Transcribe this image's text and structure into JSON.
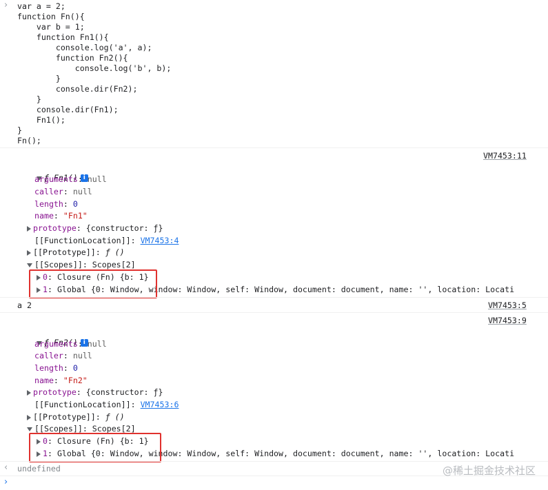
{
  "source_code": [
    "var a = 2;",
    "function Fn(){",
    "    var b = 1;",
    "    function Fn1(){",
    "        console.log('a', a);",
    "        function Fn2(){",
    "            console.log('b', b);",
    "        }",
    "        console.dir(Fn2);",
    "    }",
    "    console.dir(Fn1);",
    "    Fn1();",
    "}",
    "Fn();"
  ],
  "input_prompt_icon": "chevron-right-icon",
  "fn1_block": {
    "source_link": "VM7453:11",
    "header_f": "ƒ",
    "header_name": "Fn1()",
    "info_icon_label": "i",
    "arguments_key": "arguments",
    "arguments_val": "null",
    "caller_key": "caller",
    "caller_val": "null",
    "length_key": "length",
    "length_val": "0",
    "name_key": "name",
    "name_val": "\"Fn1\"",
    "prototype_key": "prototype",
    "prototype_val": "{constructor: ƒ}",
    "function_location_key": "[[FunctionLocation]]",
    "function_location_val": "VM7453:4",
    "proto_key": "[[Prototype]]",
    "proto_val": "ƒ ()",
    "scopes_key": "[[Scopes]]",
    "scopes_val": "Scopes[2]",
    "scope0_key": "0",
    "scope0_val": "Closure (Fn) {b: 1}",
    "scope1_key": "1",
    "scope1_val": "Global {0: Window, window: Window, self: Window, document: document, name: '', location: Locati"
  },
  "log_line": {
    "text": "a 2",
    "source_link": "VM7453:5"
  },
  "fn2_block": {
    "source_link": "VM7453:9",
    "header_f": "ƒ",
    "header_name": "Fn2()",
    "info_icon_label": "i",
    "arguments_key": "arguments",
    "arguments_val": "null",
    "caller_key": "caller",
    "caller_val": "null",
    "length_key": "length",
    "length_val": "0",
    "name_key": "name",
    "name_val": "\"Fn2\"",
    "prototype_key": "prototype",
    "prototype_val": "{constructor: ƒ}",
    "function_location_key": "[[FunctionLocation]]",
    "function_location_val": "VM7453:6",
    "proto_key": "[[Prototype]]",
    "proto_val": "ƒ ()",
    "scopes_key": "[[Scopes]]",
    "scopes_val": "Scopes[2]",
    "scope0_key": "0",
    "scope0_val": "Closure (Fn) {b: 1}",
    "scope1_key": "1",
    "scope1_val": "Global {0: Window, window: Window, self: Window, document: document, name: '', location: Locati"
  },
  "result_line": {
    "text": "undefined",
    "icon": "return-arrow-icon"
  },
  "watermark": "@稀土掘金技术社区",
  "colors": {
    "highlight_box": "#e0312e",
    "link": "#1a73e8",
    "property": "#881391",
    "string": "#c41a16"
  }
}
